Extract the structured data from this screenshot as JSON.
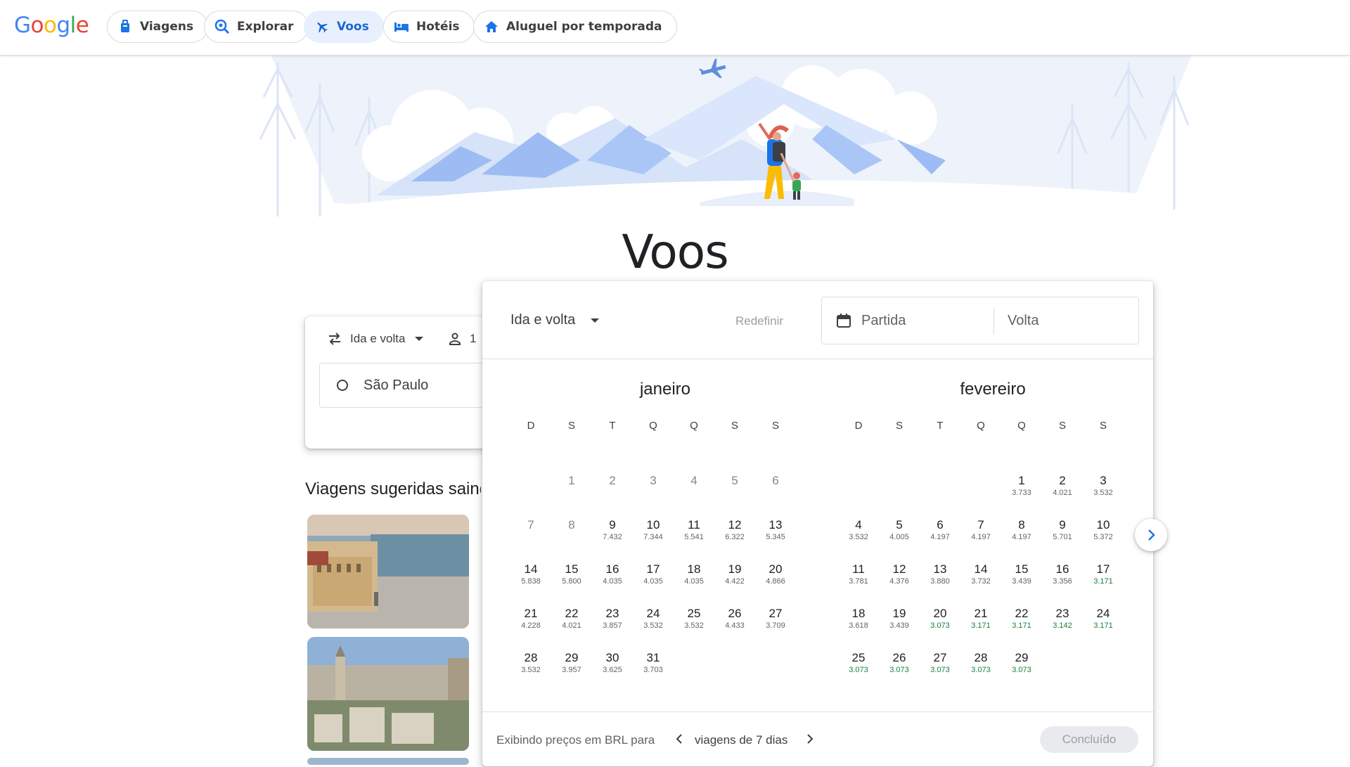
{
  "brand": {
    "letters": [
      {
        "ch": "G",
        "color": "#4285F4"
      },
      {
        "ch": "o",
        "color": "#EA4335"
      },
      {
        "ch": "o",
        "color": "#FBBC05"
      },
      {
        "ch": "g",
        "color": "#4285F4"
      },
      {
        "ch": "l",
        "color": "#34A853"
      },
      {
        "ch": "e",
        "color": "#EA4335"
      }
    ]
  },
  "nav": {
    "travel": "Viagens",
    "explore": "Explorar",
    "flights": "Voos",
    "hotels": "Hotéis",
    "rentals": "Aluguel por temporada",
    "active": "flights"
  },
  "page_title": "Voos",
  "search": {
    "trip_type": "Ida e volta",
    "passengers": "1",
    "origin": "São Paulo"
  },
  "suggestions_title": "Viagens sugeridas saindo de São Paulo",
  "picker": {
    "trip_type": "Ida e volta",
    "reset": "Redefinir",
    "departure_placeholder": "Partida",
    "return_placeholder": "Volta",
    "weekdays": [
      "D",
      "S",
      "T",
      "Q",
      "Q",
      "S",
      "S"
    ],
    "months": [
      {
        "name": "janeiro",
        "offset": 1,
        "days": [
          {
            "d": 1,
            "past": true
          },
          {
            "d": 2,
            "past": true
          },
          {
            "d": 3,
            "past": true
          },
          {
            "d": 4,
            "past": true
          },
          {
            "d": 5,
            "past": true
          },
          {
            "d": 6,
            "past": true
          },
          {
            "d": 7,
            "past": true
          },
          {
            "d": 8,
            "past": true
          },
          {
            "d": 9,
            "p": "7.432"
          },
          {
            "d": 10,
            "p": "7.344"
          },
          {
            "d": 11,
            "p": "5.541"
          },
          {
            "d": 12,
            "p": "6.322"
          },
          {
            "d": 13,
            "p": "5.345"
          },
          {
            "d": 14,
            "p": "5.838"
          },
          {
            "d": 15,
            "p": "5.800"
          },
          {
            "d": 16,
            "p": "4.035"
          },
          {
            "d": 17,
            "p": "4.035"
          },
          {
            "d": 18,
            "p": "4.035"
          },
          {
            "d": 19,
            "p": "4.422"
          },
          {
            "d": 20,
            "p": "4.866"
          },
          {
            "d": 21,
            "p": "4.228"
          },
          {
            "d": 22,
            "p": "4.021"
          },
          {
            "d": 23,
            "p": "3.857"
          },
          {
            "d": 24,
            "p": "3.532"
          },
          {
            "d": 25,
            "p": "3.532"
          },
          {
            "d": 26,
            "p": "4.433"
          },
          {
            "d": 27,
            "p": "3.709"
          },
          {
            "d": 28,
            "p": "3.532"
          },
          {
            "d": 29,
            "p": "3.957"
          },
          {
            "d": 30,
            "p": "3.625"
          },
          {
            "d": 31,
            "p": "3.703"
          }
        ]
      },
      {
        "name": "fevereiro",
        "offset": 4,
        "days": [
          {
            "d": 1,
            "p": "3.733"
          },
          {
            "d": 2,
            "p": "4.021"
          },
          {
            "d": 3,
            "p": "3.532"
          },
          {
            "d": 4,
            "p": "3.532"
          },
          {
            "d": 5,
            "p": "4.005"
          },
          {
            "d": 6,
            "p": "4.197"
          },
          {
            "d": 7,
            "p": "4.197"
          },
          {
            "d": 8,
            "p": "4.197"
          },
          {
            "d": 9,
            "p": "5.701"
          },
          {
            "d": 10,
            "p": "5.372"
          },
          {
            "d": 11,
            "p": "3.781"
          },
          {
            "d": 12,
            "p": "4.376"
          },
          {
            "d": 13,
            "p": "3.880"
          },
          {
            "d": 14,
            "p": "3.732"
          },
          {
            "d": 15,
            "p": "3.439"
          },
          {
            "d": 16,
            "p": "3.356"
          },
          {
            "d": 17,
            "p": "3.171",
            "low": true
          },
          {
            "d": 18,
            "p": "3.618"
          },
          {
            "d": 19,
            "p": "3.439"
          },
          {
            "d": 20,
            "p": "3.073",
            "low": true
          },
          {
            "d": 21,
            "p": "3.171",
            "low": true
          },
          {
            "d": 22,
            "p": "3.171",
            "low": true
          },
          {
            "d": 23,
            "p": "3.142",
            "low": true
          },
          {
            "d": 24,
            "p": "3.171",
            "low": true
          },
          {
            "d": 25,
            "p": "3.073",
            "low": true
          },
          {
            "d": 26,
            "p": "3.073",
            "low": true
          },
          {
            "d": 27,
            "p": "3.073",
            "low": true
          },
          {
            "d": 28,
            "p": "3.073",
            "low": true
          },
          {
            "d": 29,
            "p": "3.073",
            "low": true
          }
        ]
      }
    ],
    "footer_text": "Exibindo preços em BRL para",
    "footer_trip": "viagens de 7 dias",
    "done": "Concluído"
  },
  "colors": {
    "accent": "#1a73e8",
    "active_chip_bg": "#e8f0fe",
    "low_price": "#188038"
  }
}
